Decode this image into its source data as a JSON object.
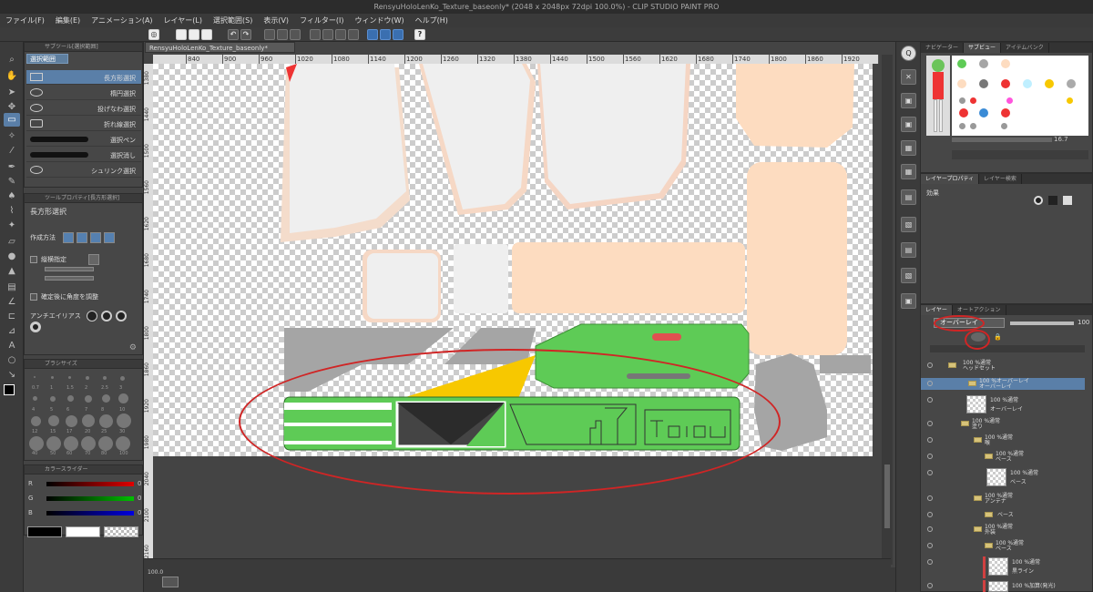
{
  "window": {
    "title": "RensyuHoloLenKo_Texture_baseonly* (2048 x 2048px 72dpi 100.0%)  - CLIP STUDIO PAINT PRO"
  },
  "menu": [
    "ファイル(F)",
    "編集(E)",
    "アニメーション(A)",
    "レイヤー(L)",
    "選択範囲(S)",
    "表示(V)",
    "フィルター(I)",
    "ウィンドウ(W)",
    "ヘルプ(H)"
  ],
  "subtool_panel": {
    "header": "サブツール[選択範囲]",
    "tab": "選択範囲",
    "items": [
      "長方形選択",
      "楕円選択",
      "投げなわ選択",
      "折れ線選択",
      "選択ペン",
      "選択消し",
      "シュリンク選択"
    ]
  },
  "tool_property": {
    "header": "ツールプロパティ[長方形選択]",
    "title": "長方形選択",
    "create_method": "作成方法",
    "aspect": "縦横指定",
    "adjust_angle": "確定後に角度を調整",
    "antialias": "アンチエイリアス"
  },
  "brush_size": {
    "header": "ブラシサイズ",
    "row1": [
      "0.7",
      "1",
      "1.5",
      "2",
      "2.5",
      "3"
    ],
    "row2": [
      "4",
      "5",
      "6",
      "7",
      "8",
      "10"
    ],
    "row3": [
      "12",
      "15",
      "17",
      "20",
      "25",
      "30"
    ],
    "row4": [
      "40",
      "50",
      "60",
      "70",
      "80",
      "100"
    ]
  },
  "color_panel": {
    "header": "カラースライダー",
    "r_label": "R",
    "g_label": "G",
    "b_label": "B",
    "r": "0",
    "g": "0",
    "b": "0"
  },
  "canvas": {
    "doc_tab": "RensyuHoloLenKo_Texture_baseonly*",
    "hruler": [
      "840",
      "900",
      "960",
      "1020",
      "1080",
      "1140",
      "1200",
      "1260",
      "1320",
      "1380",
      "1440",
      "1500",
      "1560",
      "1620",
      "1680",
      "1740",
      "1800",
      "1860",
      "1920",
      "1980",
      "2040"
    ],
    "vruler": [
      "1380",
      "1440",
      "1500",
      "1560",
      "1620",
      "1680",
      "1740",
      "1800",
      "1860",
      "1920",
      "1980",
      "2040",
      "2100",
      "2160"
    ],
    "zoom": "100.0"
  },
  "subview": {
    "tabs": [
      "ナビゲーター",
      "サブビュー",
      "アイテムバンク"
    ],
    "size_value": "16.7"
  },
  "layer_property": {
    "tabs": [
      "レイヤープロパティ",
      "レイヤー検索"
    ],
    "effect_label": "効果"
  },
  "layer_panel": {
    "tabs": [
      "レイヤー",
      "オートアクション"
    ],
    "blend_mode": "オーバーレイ",
    "opacity": "100",
    "rows": [
      {
        "mode": "100 %通常",
        "name": "ヘッドセット",
        "indent": 0
      },
      {
        "mode": "100 %オーバーレイ",
        "name": "オーバーレイ",
        "indent": 1
      },
      {
        "mode": "100 %通常",
        "name": "オーバーレイ",
        "indent": 2
      },
      {
        "mode": "100 %通常",
        "name": "塗り",
        "indent": 0
      },
      {
        "mode": "100 %通常",
        "name": "喉",
        "indent": 1
      },
      {
        "mode": "100 %通常",
        "name": "ベース",
        "indent": 2
      },
      {
        "mode": "100 %通常",
        "name": "ベース",
        "indent": 3
      },
      {
        "mode": "100 %通常",
        "name": "アンテナ",
        "indent": 1
      },
      {
        "mode": "",
        "name": "ベース",
        "indent": 2
      },
      {
        "mode": "100 %通常",
        "name": "外装",
        "indent": 1
      },
      {
        "mode": "100 %通常",
        "name": "ベース",
        "indent": 2
      },
      {
        "mode": "100 %通常",
        "name": "黒ライン",
        "indent": 3
      },
      {
        "mode": "100 %加算(発光)",
        "name": "",
        "indent": 3
      }
    ]
  },
  "colors": {
    "accent_select": "#5a7fa8",
    "annotation_red": "#d02525",
    "skin": "#fddcc0",
    "uv_grey": "#a5a5a5",
    "uv_green": "#5ecb56",
    "uv_yellow": "#f7c800"
  },
  "icons": [
    "app-menu-icon",
    "new-file-icon",
    "open-icon",
    "save-icon",
    "undo-icon",
    "redo-icon",
    "help-icon",
    "eye-icon",
    "folder-icon",
    "lock-icon"
  ]
}
